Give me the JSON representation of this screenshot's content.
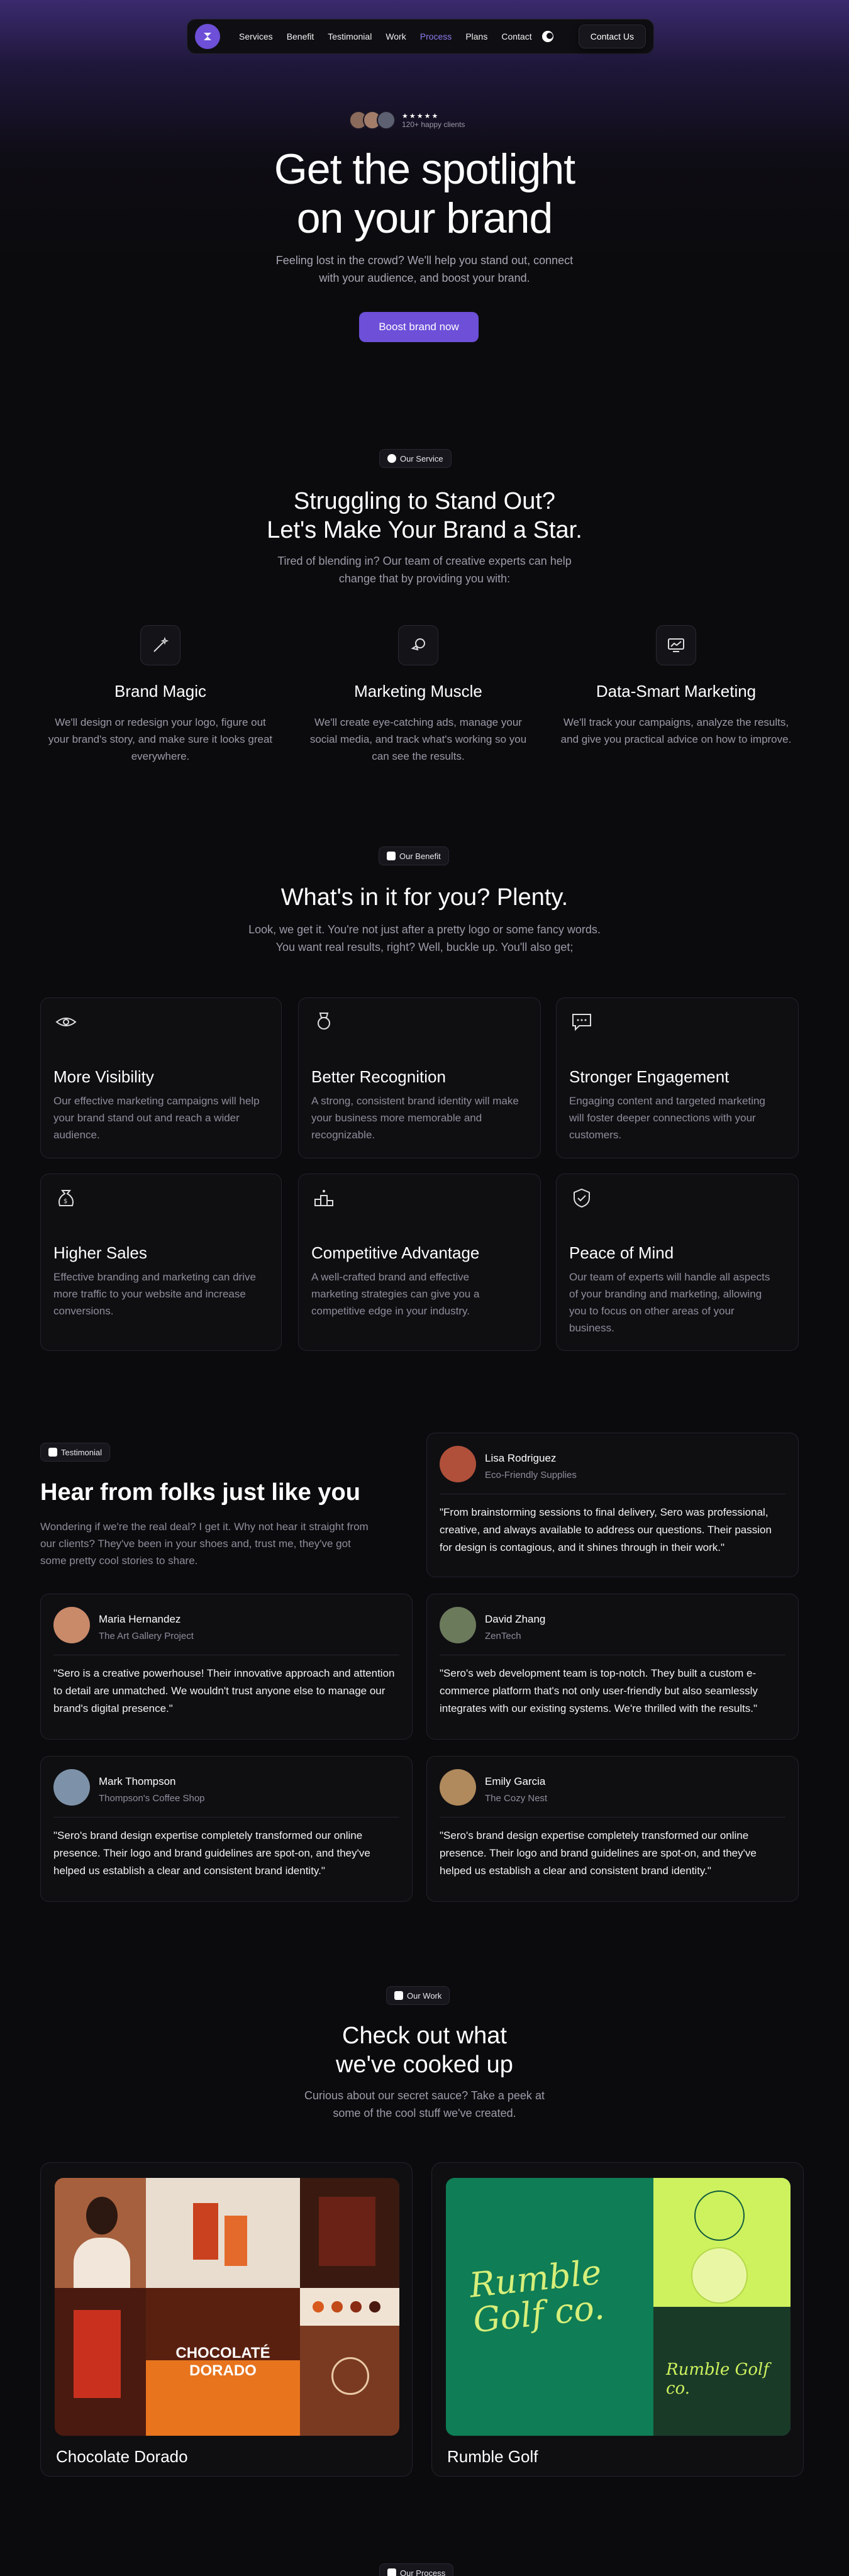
{
  "nav": {
    "links": [
      "Services",
      "Benefit",
      "Testimonial",
      "Work",
      "Process",
      "Plans",
      "Contact"
    ],
    "active": "Process",
    "contact_label": "Contact Us"
  },
  "hero": {
    "stars": "★★★★★",
    "clients": "120+ happy clients",
    "title_line1": "Get the spotlight",
    "title_line2": "on your brand",
    "subtitle": "Feeling lost in the crowd? We'll help you stand out, connect with your audience, and boost your brand.",
    "cta": "Boost brand now"
  },
  "services": {
    "badge": "Our Service",
    "title_line1": "Struggling to Stand Out?",
    "title_line2": "Let's Make Your Brand a Star.",
    "subtitle": "Tired of blending in? Our team of creative experts can help change that by providing you with:",
    "items": [
      {
        "icon": "magic-wand-icon",
        "title": "Brand Magic",
        "desc": "We'll design or redesign  your logo, figure out your brand's story, and make sure it looks great everywhere."
      },
      {
        "icon": "megaphone-icon",
        "title": "Marketing Muscle",
        "desc": "We'll create eye-catching ads, manage your social media, and track what's working so you can see the results."
      },
      {
        "icon": "analytics-chart-icon",
        "title": "Data-Smart Marketing",
        "desc": "We'll track your campaigns, analyze the results, and give you practical advice on how to improve."
      }
    ]
  },
  "benefits": {
    "badge": "Our Benefit",
    "title": "What's in it for you? Plenty.",
    "subtitle": "Look, we get it. You're not just after a pretty logo or some fancy words. You want real results, right? Well, buckle up. You'll also get;",
    "items": [
      {
        "icon": "eye-icon",
        "title": "More Visibility",
        "desc": "Our effective marketing campaigns will help your brand stand out and reach a wider audience."
      },
      {
        "icon": "medal-icon",
        "title": "Better Recognition",
        "desc": "A strong, consistent brand identity will make your business more memorable and recognizable."
      },
      {
        "icon": "chat-bubble-icon",
        "title": "Stronger Engagement",
        "desc": "Engaging content and targeted marketing will foster deeper connections with your customers."
      },
      {
        "icon": "money-bag-icon",
        "title": "Higher Sales",
        "desc": "Effective branding and marketing can drive more traffic to your website and increase conversions."
      },
      {
        "icon": "podium-icon",
        "title": "Competitive Advantage",
        "desc": "A well-crafted brand and effective marketing strategies can give you a competitive edge in your industry."
      },
      {
        "icon": "shield-check-icon",
        "title": "Peace of Mind",
        "desc": "Our team of experts will handle all aspects of your branding and marketing, allowing you to focus on other areas of your business."
      }
    ]
  },
  "testimonials": {
    "badge": "Testimonial",
    "title": "Hear from folks just like you",
    "subtitle": "Wondering if we're the real deal? I get it. Why not hear it straight from our clients? They've been in your shoes and, trust me, they've got some pretty cool stories to share.",
    "items": [
      {
        "name": "Lisa Rodriguez",
        "company": "Eco-Friendly Supplies",
        "quote": "\"From brainstorming sessions to final delivery, Sero was professional, creative, and always available to address our questions. Their passion for design is contagious, and it shines through in their work.\"",
        "avatar_color": "#b0503a"
      },
      {
        "name": "Maria Hernandez",
        "company": "The Art Gallery Project",
        "quote": "\"Sero is a creative powerhouse! Their innovative approach and attention to detail are unmatched. We wouldn't trust anyone else to manage our brand's digital presence.\"",
        "avatar_color": "#c98a6a"
      },
      {
        "name": "David Zhang",
        "company": "ZenTech",
        "quote": "\"Sero's web development team is top-notch. They built a custom e-commerce platform that's not only user-friendly but also seamlessly integrates with our existing systems. We're thrilled with the results.\"",
        "avatar_color": "#6c7a5c"
      },
      {
        "name": "Mark Thompson",
        "company": "Thompson's Coffee Shop",
        "quote": "\"Sero's brand design expertise completely transformed our online presence. Their logo and brand guidelines are spot-on, and they've helped us establish a clear and consistent brand identity.\"",
        "avatar_color": "#7d92a8"
      },
      {
        "name": "Emily Garcia",
        "company": "The Cozy Nest",
        "quote": "\"Sero's brand design expertise completely transformed our online presence. Their logo and brand guidelines are spot-on, and they've helped us establish a clear and consistent brand identity.\"",
        "avatar_color": "#b08a5c"
      }
    ]
  },
  "work": {
    "badge": "Our Work",
    "title_line1": "Check out what",
    "title_line2": "we've cooked up",
    "subtitle": "Curious about our secret sauce? Take a peek at some of the cool stuff we've created.",
    "items": [
      {
        "title": "Chocolate Dorado",
        "brand_text": "CHOCOLATÉ DORADO"
      },
      {
        "title": "Rumble Golf",
        "brand_text": "Rumble Golf co."
      }
    ]
  },
  "process": {
    "badge": "Our Process"
  }
}
